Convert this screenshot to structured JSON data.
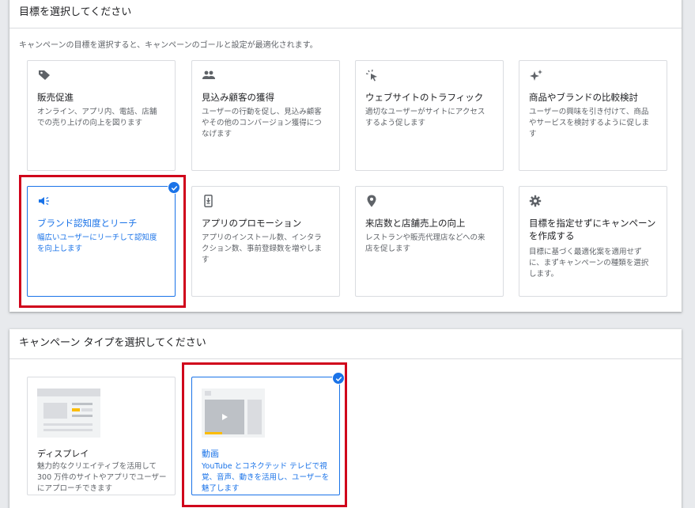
{
  "goal_section": {
    "title": "目標を選択してください",
    "subtitle": "キャンペーンの目標を選択すると、キャンペーンのゴールと設定が最適化されます。",
    "cards": [
      {
        "icon": "tag-icon",
        "title": "販売促進",
        "desc": "オンライン、アプリ内、電話、店舗での売り上げの向上を図ります",
        "selected": false
      },
      {
        "icon": "people-icon",
        "title": "見込み顧客の獲得",
        "desc": "ユーザーの行動を促し、見込み顧客やその他のコンバージョン獲得につなげます",
        "selected": false
      },
      {
        "icon": "click-sparkle-icon",
        "title": "ウェブサイトのトラフィック",
        "desc": "適切なユーザーがサイトにアクセスするよう促します",
        "selected": false
      },
      {
        "icon": "sparkle-icon",
        "title": "商品やブランドの比較検討",
        "desc": "ユーザーの興味を引き付けて、商品やサービスを検討するように促します",
        "selected": false
      },
      {
        "icon": "speaker-icon",
        "title": "ブランド認知度とリーチ",
        "desc": "幅広いユーザーにリーチして認知度を向上します",
        "selected": true
      },
      {
        "icon": "phone-download-icon",
        "title": "アプリのプロモーション",
        "desc": "アプリのインストール数、インタラクション数、事前登録数を増やします",
        "selected": false
      },
      {
        "icon": "location-pin-icon",
        "title": "来店数と店舗売上の向上",
        "desc": "レストランや販売代理店などへの来店を促します",
        "selected": false
      },
      {
        "icon": "gear-icon",
        "title": "目標を指定せずにキャンペーンを作成する",
        "desc": "目標に基づく最適化案を適用せずに、まずキャンペーンの種類を選択します。",
        "selected": false
      }
    ]
  },
  "type_section": {
    "title": "キャンペーン タイプを選択してください",
    "cards": [
      {
        "icon": "display-ad-illustration",
        "title": "ディスプレイ",
        "desc": "魅力的なクリエイティブを活用して 300 万件のサイトやアプリでユーザーにアプローチできます",
        "selected": false
      },
      {
        "icon": "video-ad-illustration",
        "title": "動画",
        "desc": "YouTube とコネクテッド テレビで視覚、音声、動きを活用し、ユーザーを魅了します",
        "selected": true
      }
    ]
  },
  "colors": {
    "accent": "#1a73e8",
    "highlight": "#d0021b",
    "icon": "#5f6368"
  }
}
